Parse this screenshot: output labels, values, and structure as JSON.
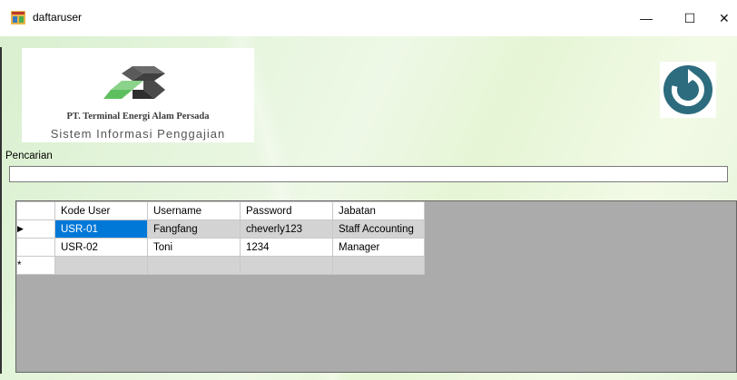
{
  "window": {
    "title": "daftaruser",
    "minimize_glyph": "—",
    "maximize_glyph": "☐",
    "close_glyph": "✕",
    "icon": "form-icon"
  },
  "logo": {
    "company": "PT. Terminal Energi Alam Persada",
    "subtitle": "Sistem Informasi Penggajian",
    "icon": "cube-logo-icon"
  },
  "refresh": {
    "icon": "refresh-icon",
    "color": "#2d6c7e"
  },
  "search": {
    "label": "Pencarian",
    "value": ""
  },
  "grid": {
    "columns": [
      "Kode User",
      "Username",
      "Password",
      "Jabatan"
    ],
    "rows": [
      [
        "USR-01",
        "Fangfang",
        "cheverly123",
        "Staff Accounting"
      ],
      [
        "USR-02",
        "Toni",
        "1234",
        "Manager"
      ]
    ],
    "current_row_marker": "▶",
    "new_row_marker": "*",
    "selection_color": "#0078d7"
  }
}
